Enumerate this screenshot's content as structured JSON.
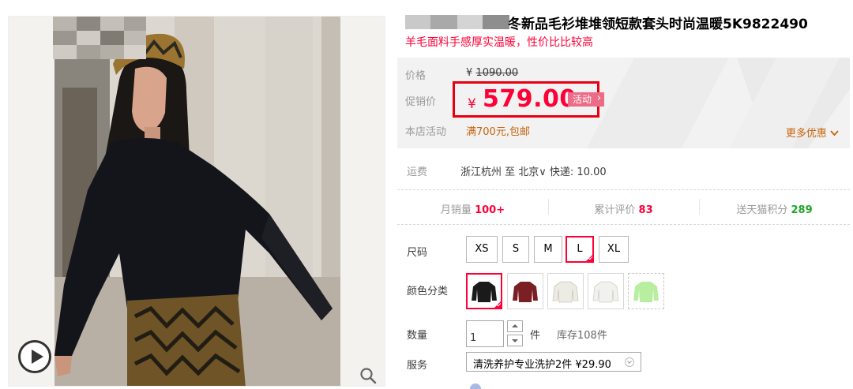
{
  "gallery": {
    "play_icon": "play-circle-icon",
    "zoom_icon": "magnifier-icon"
  },
  "product": {
    "title": "冬新品毛衫堆堆领短款套头时尚温暖5K9822490",
    "subtitle": "羊毛面料手感厚实温暖，性价比比较高"
  },
  "price": {
    "original_label": "价格",
    "original_currency": "¥",
    "original_value": "1090.00",
    "promo_label": "促销价",
    "promo_currency": "¥",
    "promo_value": "579.00",
    "activity_tag": "活动",
    "shop_activity_label": "本店活动",
    "shop_activity_text": "满700元,包邮",
    "more_deals": "更多优惠",
    "accent_color": "#ff0036"
  },
  "shipping": {
    "label": "运费",
    "text": "浙江杭州 至 北京∨ 快递: 10.00"
  },
  "stats": {
    "monthly_sales_label": "月销量",
    "monthly_sales_value": "100+",
    "reviews_label": "累计评价",
    "reviews_value": "83",
    "points_label": "送天猫积分",
    "points_value": "289"
  },
  "options": {
    "size_label": "尺码",
    "sizes": [
      "XS",
      "S",
      "M",
      "L",
      "XL"
    ],
    "selected_size": "L",
    "color_label": "颜色分类",
    "colors": [
      "#1a1a1a",
      "#7a1f24",
      "#ecebe4",
      "#f1f1ee",
      "#b8eea0"
    ],
    "selected_color_index": 0
  },
  "quantity": {
    "label": "数量",
    "value": "1",
    "unit": "件",
    "stock": "库存108件"
  },
  "service": {
    "label": "服务",
    "selected": "清洗养护专业洗护2件 ¥29.90"
  }
}
